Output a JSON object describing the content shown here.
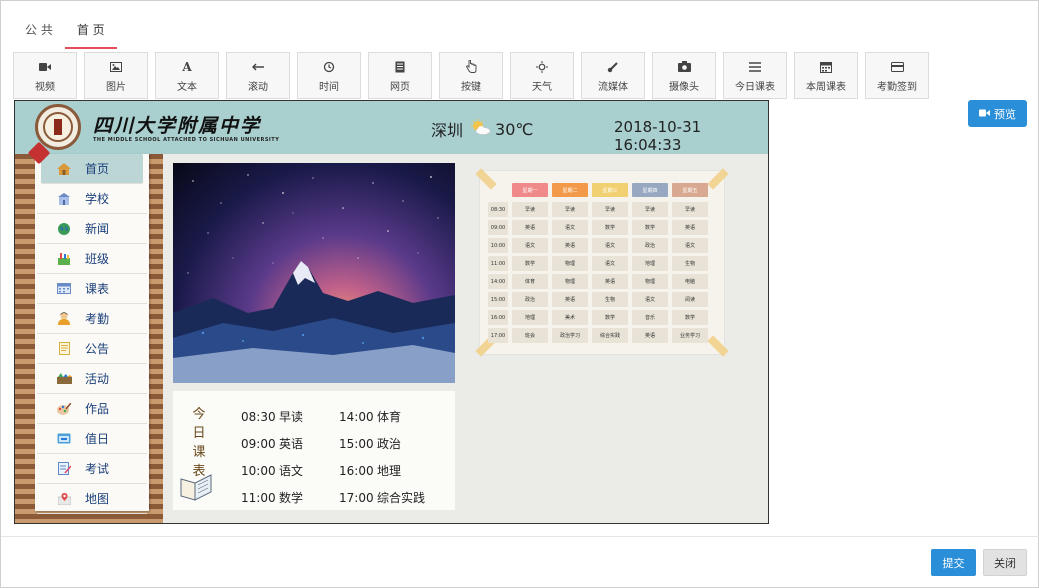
{
  "tabs": [
    {
      "label": "公 共",
      "active": false
    },
    {
      "label": "首 页",
      "active": true
    }
  ],
  "toolbar": [
    {
      "label": "视频",
      "icon": "video-icon"
    },
    {
      "label": "图片",
      "icon": "image-icon"
    },
    {
      "label": "文本",
      "icon": "text-icon"
    },
    {
      "label": "滚动",
      "icon": "scroll-arrow-icon"
    },
    {
      "label": "时间",
      "icon": "clock-history-icon"
    },
    {
      "label": "网页",
      "icon": "webpage-icon"
    },
    {
      "label": "按键",
      "icon": "hand-pointer-icon"
    },
    {
      "label": "天气",
      "icon": "sun-icon"
    },
    {
      "label": "流媒体",
      "icon": "stream-icon"
    },
    {
      "label": "摄像头",
      "icon": "camera-icon"
    },
    {
      "label": "今日课表",
      "icon": "list-icon"
    },
    {
      "label": "本周课表",
      "icon": "calendar-icon"
    },
    {
      "label": "考勤签到",
      "icon": "card-icon"
    }
  ],
  "preview_label": "预览",
  "banner": {
    "school_name": "四川大学附属中学",
    "school_name_en": "THE MIDDLE SCHOOL ATTACHED TO SICHUAN UNIVERSITY",
    "city": "深圳",
    "temperature": "30℃",
    "datetime": "2018-10-31 16:04:33"
  },
  "nav": [
    {
      "label": "首页",
      "icon": "home-icon",
      "active": true
    },
    {
      "label": "学校",
      "icon": "school-building-icon"
    },
    {
      "label": "新闻",
      "icon": "globe-icon"
    },
    {
      "label": "班级",
      "icon": "class-icon"
    },
    {
      "label": "课表",
      "icon": "timetable-icon"
    },
    {
      "label": "考勤",
      "icon": "user-icon"
    },
    {
      "label": "公告",
      "icon": "notice-icon"
    },
    {
      "label": "活动",
      "icon": "activity-icon"
    },
    {
      "label": "作品",
      "icon": "palette-icon"
    },
    {
      "label": "值日",
      "icon": "duty-icon"
    },
    {
      "label": "考试",
      "icon": "exam-icon"
    },
    {
      "label": "地图",
      "icon": "map-icon"
    }
  ],
  "today": {
    "title": [
      "今",
      "日",
      "课",
      "表"
    ],
    "rows": [
      {
        "t1": "08:30",
        "s1": "早读",
        "t2": "14:00",
        "s2": "体育"
      },
      {
        "t1": "09:00",
        "s1": "英语",
        "t2": "15:00",
        "s2": "政治"
      },
      {
        "t1": "10:00",
        "s1": "语文",
        "t2": "16:00",
        "s2": "地理"
      },
      {
        "t1": "11:00",
        "s1": "数学",
        "t2": "17:00",
        "s2": "综合实践"
      }
    ]
  },
  "week": {
    "days": [
      {
        "label": "星期一",
        "color": "#f08a8a"
      },
      {
        "label": "星期二",
        "color": "#f29a4a"
      },
      {
        "label": "星期三",
        "color": "#f0d070"
      },
      {
        "label": "星期四",
        "color": "#98a8c0"
      },
      {
        "label": "星期五",
        "color": "#d8a890"
      }
    ],
    "rows": [
      {
        "time": "08:30",
        "cells": [
          "早读",
          "早读",
          "早读",
          "早读",
          "早读"
        ]
      },
      {
        "time": "09:00",
        "cells": [
          "英语",
          "语文",
          "数学",
          "数学",
          "英语"
        ]
      },
      {
        "time": "10:00",
        "cells": [
          "语文",
          "英语",
          "语文",
          "政治",
          "语文"
        ]
      },
      {
        "time": "11:00",
        "cells": [
          "数学",
          "物理",
          "语文",
          "地理",
          "生物"
        ]
      },
      {
        "time": "14:00",
        "cells": [
          "体育",
          "物理",
          "英语",
          "物理",
          "电脑"
        ]
      },
      {
        "time": "15:00",
        "cells": [
          "政治",
          "英语",
          "生物",
          "语文",
          "阅读"
        ]
      },
      {
        "time": "16:00",
        "cells": [
          "地理",
          "美术",
          "数学",
          "音乐",
          "数学"
        ]
      },
      {
        "time": "17:00",
        "cells": [
          "班会",
          "政治学习",
          "综合实践",
          "英语",
          "业务学习"
        ]
      }
    ]
  },
  "footer": {
    "submit": "提交",
    "close": "关闭"
  }
}
